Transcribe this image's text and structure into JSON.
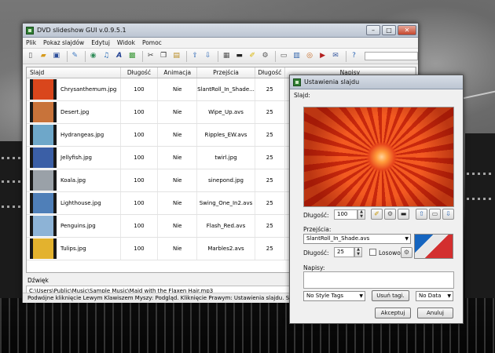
{
  "main_window": {
    "title": "DVD slideshow GUI v.0.9.5.1",
    "menu": [
      "Plik",
      "Pokaz slajdów",
      "Edytuj",
      "Widok",
      "Pomoc"
    ],
    "columns": [
      "Slajd",
      "Długość",
      "Animacja",
      "Przejścia",
      "Długość",
      "Napisy"
    ],
    "rows": [
      {
        "name": "Chrysanthemum.jpg",
        "duration": "100",
        "animation": "Nie",
        "transition": "SlantRoll_In_Shade...",
        "trans_len": "25",
        "captions": "",
        "thumb_color": "#d9461c"
      },
      {
        "name": "Desert.jpg",
        "duration": "100",
        "animation": "Nie",
        "transition": "Wipe_Up.avs",
        "trans_len": "25",
        "captions": "",
        "thumb_color": "#c8733a"
      },
      {
        "name": "Hydrangeas.jpg",
        "duration": "100",
        "animation": "Nie",
        "transition": "Ripples_EW.avs",
        "trans_len": "25",
        "captions": "",
        "thumb_color": "#6ea7c9"
      },
      {
        "name": "Jellyfish.jpg",
        "duration": "100",
        "animation": "Nie",
        "transition": "twirl.jpg",
        "trans_len": "25",
        "captions": "",
        "thumb_color": "#3b5fa6"
      },
      {
        "name": "Koala.jpg",
        "duration": "100",
        "animation": "Nie",
        "transition": "sinepond.jpg",
        "trans_len": "25",
        "captions": "",
        "thumb_color": "#9aa1a8"
      },
      {
        "name": "Lighthouse.jpg",
        "duration": "100",
        "animation": "Nie",
        "transition": "Swing_One_In2.avs",
        "trans_len": "25",
        "captions": "",
        "thumb_color": "#4f7fb8"
      },
      {
        "name": "Penguins.jpg",
        "duration": "100",
        "animation": "Nie",
        "transition": "Flash_Red.avs",
        "trans_len": "25",
        "captions": "",
        "thumb_color": "#8db3d6"
      },
      {
        "name": "Tulips.jpg",
        "duration": "100",
        "animation": "Nie",
        "transition": "Marbles2.avs",
        "trans_len": "25",
        "captions": "",
        "thumb_color": "#e3b22e"
      }
    ],
    "sound_label": "Dźwięk",
    "sound_path": "C:\\Users\\Public\\Music\\Sample Music\\Maid with the Flaxen Hair.mp3",
    "status": "Podwójne kliknięcie Lewym Klawiszem Myszy: Podgląd. Kliknięcie Prawym: Ustawienia slajdu. Shift/Ctrl zaznacza"
  },
  "dialog": {
    "title": "Ustawienia slajdu",
    "slide_label": "Slajd:",
    "duration_label": "Długość:",
    "duration_value": "100",
    "transitions_label": "Przejścia:",
    "transition_value": "SlantRoll_In_Shade.avs",
    "trans_duration_label": "Długość:",
    "trans_duration_value": "25",
    "random_label": "Losowo",
    "captions_label": "Napisy:",
    "style_tags": "No Style Tags",
    "remove_tags": "Usuń tagi.",
    "no_data": "No Data",
    "ok": "Akceptuj",
    "cancel": "Anuluj"
  }
}
